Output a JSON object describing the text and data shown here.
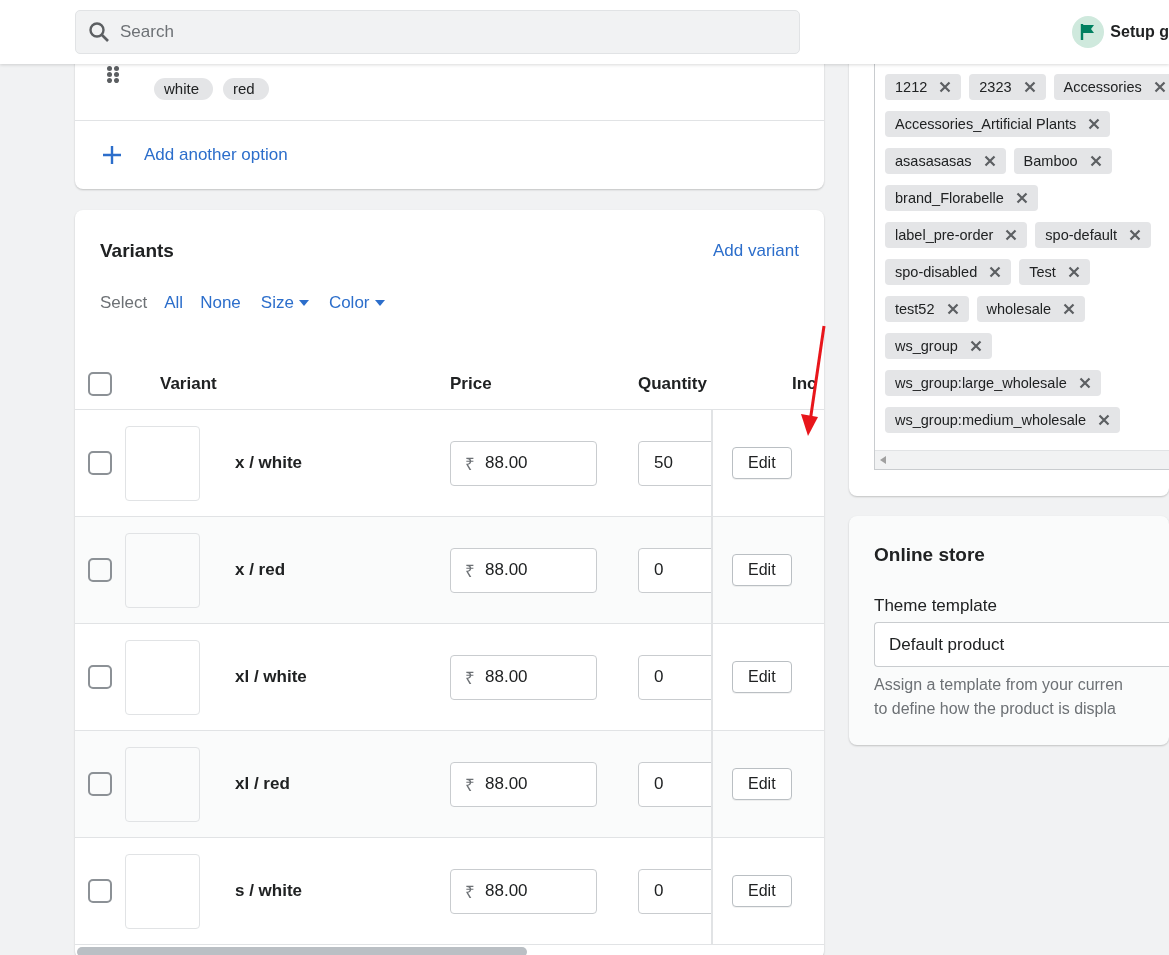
{
  "top_bar": {
    "search": {
      "placeholder": "Search"
    },
    "setup_guide": "Setup g"
  },
  "options_card": {
    "option": {
      "values": [
        "white",
        "red"
      ]
    },
    "add_option": "Add another option"
  },
  "variants": {
    "title": "Variants",
    "add_variant": "Add variant",
    "select": {
      "label": "Select",
      "links": [
        {
          "label": "All",
          "kind": "link"
        },
        {
          "label": "None",
          "kind": "link"
        },
        {
          "label": "Size",
          "kind": "dropdown"
        },
        {
          "label": "Color",
          "kind": "dropdown"
        }
      ]
    },
    "table": {
      "header_checked": false,
      "columns": [
        "Variant",
        "Price",
        "Quantity",
        "Inc"
      ],
      "rows": [
        {
          "checked": false,
          "variant": "x / white",
          "currency": "₹",
          "price": "88.00",
          "quantity": "50",
          "action": "Edit"
        },
        {
          "checked": false,
          "variant": "x / red",
          "currency": "₹",
          "price": "88.00",
          "quantity": "0",
          "action": "Edit"
        },
        {
          "checked": false,
          "variant": "xl / white",
          "currency": "₹",
          "price": "88.00",
          "quantity": "0",
          "action": "Edit"
        },
        {
          "checked": false,
          "variant": "xl / red",
          "currency": "₹",
          "price": "88.00",
          "quantity": "0",
          "action": "Edit"
        },
        {
          "checked": false,
          "variant": "s / white",
          "currency": "₹",
          "price": "88.00",
          "quantity": "0",
          "action": "Edit"
        }
      ]
    }
  },
  "tags": {
    "rows": [
      [
        "1212",
        "2323",
        "Accessories"
      ],
      [
        "Accessories_Artificial Plants"
      ],
      [
        "asasasasas",
        "Bamboo"
      ],
      [
        "brand_Florabelle"
      ],
      [
        "label_pre-order",
        "spo-default"
      ],
      [
        "spo-disabled",
        "Test"
      ],
      [
        "test52",
        "wholesale"
      ],
      [
        "ws_group"
      ],
      [
        "ws_group:large_wholesale"
      ],
      [
        "ws_group:medium_wholesale"
      ]
    ]
  },
  "online_store": {
    "title": "Online store",
    "label": "Theme template",
    "value": "Default product",
    "help": [
      "Assign a template from your curren",
      "to define how the product is displa"
    ]
  }
}
